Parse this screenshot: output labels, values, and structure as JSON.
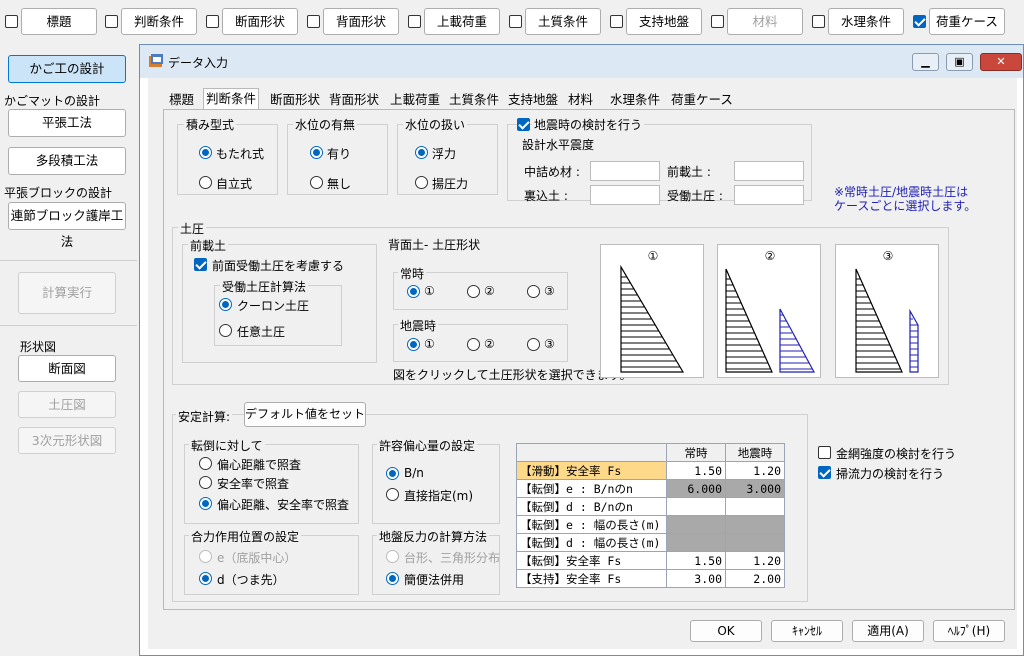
{
  "top_tabs": [
    {
      "label": "標題",
      "checked": false,
      "disabled": false
    },
    {
      "label": "判断条件",
      "checked": false,
      "disabled": false
    },
    {
      "label": "断面形状",
      "checked": false,
      "disabled": false
    },
    {
      "label": "背面形状",
      "checked": false,
      "disabled": false
    },
    {
      "label": "上載荷重",
      "checked": false,
      "disabled": false
    },
    {
      "label": "土質条件",
      "checked": false,
      "disabled": false
    },
    {
      "label": "支持地盤",
      "checked": false,
      "disabled": false
    },
    {
      "label": "材料",
      "checked": false,
      "disabled": true
    },
    {
      "label": "水理条件",
      "checked": false,
      "disabled": false
    },
    {
      "label": "荷重ケース",
      "checked": true,
      "disabled": false
    }
  ],
  "left": {
    "kagoko_button": "かご工の設計",
    "kagomat_label": "かごマットの設計",
    "hirabari_button": "平張工法",
    "tadan_button": "多段積工法",
    "block_label": "平張ブロックの設計",
    "renketsu_button": "連節ブロック護岸工法",
    "calc_button": "計算実行",
    "shape_label": "形状図",
    "danmen_button": "断面図",
    "doatsu_button": "土圧図",
    "sanji_button": "3次元形状図"
  },
  "window": {
    "title": "データ入力",
    "tabs": [
      "標題",
      "判断条件",
      "断面形状",
      "背面形状",
      "上載荷重",
      "土質条件",
      "支持地盤",
      "材料",
      "水理条件",
      "荷重ケース"
    ],
    "active_tab": "判断条件"
  },
  "form": {
    "tsumi": {
      "title": "積み型式",
      "options": [
        "もたれ式",
        "自立式"
      ],
      "selected": 0
    },
    "suii": {
      "title": "水位の有無",
      "options": [
        "有り",
        "無し"
      ],
      "selected": 0
    },
    "suii_atsukai": {
      "title": "水位の扱い",
      "options": [
        "浮力",
        "揚圧力"
      ],
      "selected": 0
    },
    "jishin": {
      "check_label": "地震時の検討を行う",
      "checked": true,
      "sub_title": "設計水平震度",
      "nakazume_label": "中詰め材 :",
      "nakazume_value": "",
      "maezumi_label": "前載土 :",
      "maezumi_value": "",
      "urakomi_label": "裏込土 :",
      "urakomi_value": "",
      "judo_label": "受働土圧 :",
      "judo_value": ""
    },
    "note": "※常時土圧/地震時土圧は\nケースごとに選択します。",
    "doatsu": {
      "title": "土圧",
      "maezai_title": "前載土",
      "maezai_check": "前面受働土圧を考慮する",
      "maezai_checked": true,
      "judo_calc_title": "受働土圧計算法",
      "judo_options": [
        "クーロン土圧",
        "任意土圧"
      ],
      "judo_selected": 0,
      "haimen_title": "背面土- 土圧形状",
      "joji_title": "常時",
      "joji_options": [
        "①",
        "②",
        "③"
      ],
      "joji_selected": 0,
      "jishinji_title": "地震時",
      "jishinji_options": [
        "①",
        "②",
        "③"
      ],
      "jishinji_selected": 0,
      "hint": "図をクリックして土圧形状を選択できます。",
      "pictures": [
        "①",
        "②",
        "③"
      ]
    },
    "antei": {
      "title": "安定計算:",
      "default_button": "デフォルト値をセット",
      "tento_title": "転倒に対して",
      "tento_options": [
        "偏心距離で照査",
        "安全率で照査",
        "偏心距離、安全率で照査"
      ],
      "tento_selected": 2,
      "gouryoku_title": "合力作用位置の設定",
      "gouryoku_options": [
        "e（底版中心）",
        "d（つま先）"
      ],
      "gouryoku_selected": 1,
      "kyoyo_title": "許容偏心量の設定",
      "kyoyo_options": [
        "B/n",
        "直接指定(m)"
      ],
      "kyoyo_selected": 0,
      "jiban_title": "地盤反力の計算方法",
      "jiban_options": [
        "台形、三角形分布",
        "簡便法併用"
      ],
      "jiban_selected": 1
    },
    "table": {
      "headers": [
        "常時",
        "地震時"
      ],
      "rows": [
        {
          "label": "【滑動】安全率 Fs",
          "v1": "1.50",
          "v2": "1.20",
          "highlight": true,
          "gray": false
        },
        {
          "label": "【転倒】e : B/nのn",
          "v1": "6.000",
          "v2": "3.000",
          "highlight": false,
          "gray": true
        },
        {
          "label": "【転倒】d : B/nのn",
          "v1": "",
          "v2": "",
          "highlight": false,
          "gray": false
        },
        {
          "label": "【転倒】e : 幅の長さ(m)",
          "v1": "",
          "v2": "",
          "highlight": false,
          "gray": true
        },
        {
          "label": "【転倒】d : 幅の長さ(m)",
          "v1": "",
          "v2": "",
          "highlight": false,
          "gray": true
        },
        {
          "label": "【転倒】安全率 Fs",
          "v1": "1.50",
          "v2": "1.20",
          "highlight": false,
          "gray": false
        },
        {
          "label": "【支持】安全率 Fs",
          "v1": "3.00",
          "v2": "2.00",
          "highlight": false,
          "gray": false
        }
      ]
    },
    "kanamo_check": "金網強度の検討を行う",
    "kanamo_checked": false,
    "soryu_check": "掃流力の検討を行う",
    "soryu_checked": true
  },
  "footer": {
    "ok": "OK",
    "cancel": "ｷｬﾝｾﾙ",
    "apply": "適用(A)",
    "help": "ﾍﾙﾌﾟ(H)"
  }
}
